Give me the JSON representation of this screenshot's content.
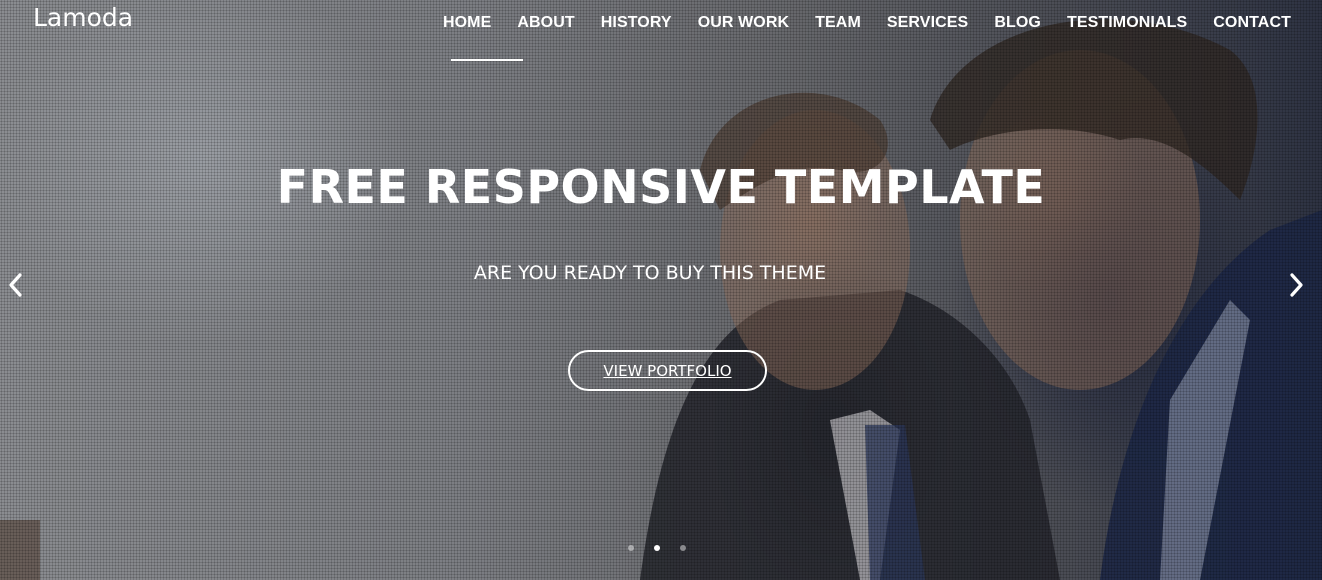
{
  "brand": {
    "name": "Lamoda"
  },
  "nav": {
    "items": [
      {
        "label": "HOME"
      },
      {
        "label": "ABOUT"
      },
      {
        "label": "HISTORY"
      },
      {
        "label": "OUR WORK"
      },
      {
        "label": "TEAM"
      },
      {
        "label": "SERVICES"
      },
      {
        "label": "BLOG"
      },
      {
        "label": "TESTIMONIALS"
      },
      {
        "label": "CONTACT"
      }
    ],
    "active_index": 0
  },
  "hero": {
    "title": "FREE RESPONSIVE TEMPLATE",
    "subtitle": "ARE YOU READY TO BUY THIS THEME",
    "cta_label": "VIEW PORTFOLIO"
  },
  "carousel": {
    "prev_icon": "chevron-left-icon",
    "next_icon": "chevron-right-icon",
    "slide_count": 3,
    "active_slide": 2
  },
  "colors": {
    "text": "#ffffff",
    "overlay": "#6e7075"
  }
}
